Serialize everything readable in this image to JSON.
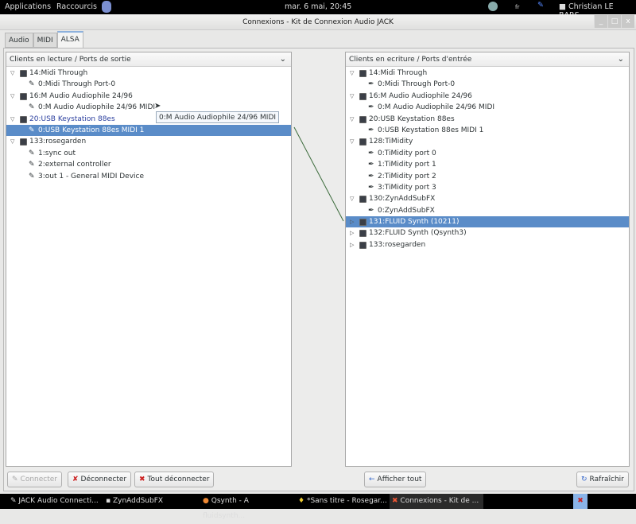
{
  "topbar": {
    "applications": "Applications",
    "shortcuts": "Raccourcis",
    "clock": "mar.  6 mai, 20:45",
    "lang": "fr",
    "user": "Christian LE BARS"
  },
  "window": {
    "title": "Connexions - Kit de Connexion Audio JACK",
    "min": "_",
    "max": "□",
    "close": "x"
  },
  "tabs": [
    "Audio",
    "MIDI",
    "ALSA"
  ],
  "left": {
    "header": "Clients en lecture / Ports de sortie",
    "rows": [
      {
        "t": "client",
        "label": "14:Midi Through"
      },
      {
        "t": "port",
        "label": "0:Midi Through Port-0"
      },
      {
        "t": "client",
        "label": "16:M Audio Audiophile 24/96"
      },
      {
        "t": "port",
        "label": "0:M Audio Audiophile 24/96 MIDI"
      },
      {
        "t": "client",
        "label": "20:USB Keystation 88es",
        "hl": true
      },
      {
        "t": "port",
        "label": "0:USB Keystation 88es MIDI 1",
        "sel": true
      },
      {
        "t": "client",
        "label": "133:rosegarden"
      },
      {
        "t": "port",
        "label": "1:sync out"
      },
      {
        "t": "port",
        "label": "2:external controller"
      },
      {
        "t": "port",
        "label": "3:out 1 - General MIDI Device"
      }
    ]
  },
  "tooltip": "0:M Audio Audiophile 24/96 MIDI",
  "right": {
    "header": "Clients en ecriture / Ports d'entrée",
    "rows": [
      {
        "t": "client",
        "label": "14:Midi Through"
      },
      {
        "t": "port",
        "label": "0:Midi Through Port-0"
      },
      {
        "t": "client",
        "label": "16:M Audio Audiophile 24/96"
      },
      {
        "t": "port",
        "label": "0:M Audio Audiophile 24/96 MIDI"
      },
      {
        "t": "client",
        "label": "20:USB Keystation 88es"
      },
      {
        "t": "port",
        "label": "0:USB Keystation 88es MIDI 1"
      },
      {
        "t": "client",
        "label": "128:TiMidity"
      },
      {
        "t": "port",
        "label": "0:TiMidity port 0"
      },
      {
        "t": "port",
        "label": "1:TiMidity port 1"
      },
      {
        "t": "port",
        "label": "2:TiMidity port 2"
      },
      {
        "t": "port",
        "label": "3:TiMidity port 3"
      },
      {
        "t": "client",
        "label": "130:ZynAddSubFX"
      },
      {
        "t": "port",
        "label": "0:ZynAddSubFX"
      },
      {
        "t": "client",
        "label": "131:FLUID Synth (10211)",
        "sel": true,
        "collapsed": true
      },
      {
        "t": "client",
        "label": "132:FLUID Synth (Qsynth3)",
        "collapsed": true
      },
      {
        "t": "client",
        "label": "133:rosegarden",
        "collapsed": true
      }
    ]
  },
  "buttons": {
    "connect": "Connecter",
    "disconnect": "Déconnecter",
    "disconnect_all": "Tout déconnecter",
    "show_all": "Afficher tout",
    "refresh": "Rafraîchir"
  },
  "taskbar": [
    "JACK Audio Connecti...",
    "ZynAddSubFX",
    "Qsynth - A fluidsynth...",
    "*Sans titre - Rosegar...",
    "Connexions - Kit de ..."
  ]
}
